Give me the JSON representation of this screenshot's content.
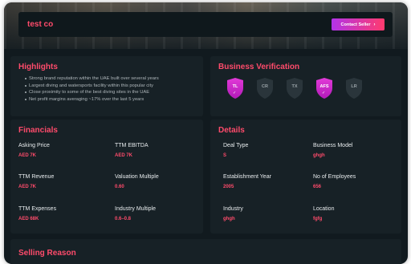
{
  "header": {
    "company_name": "test co",
    "contact_button_label": "Contact Seller",
    "contact_button_arrow": "›"
  },
  "highlights": {
    "title": "Highlights",
    "items": [
      "Strong brand reputation within the UAE built over several years",
      "Largest diving and watersports facility within this popular city",
      "Close proximity to some of the best diving sites in the UAE",
      "Net profit margins averaging ~17% over the last 5 years"
    ]
  },
  "verification": {
    "title": "Business Verification",
    "badges": [
      {
        "label": "TL",
        "active": true,
        "check": "✓"
      },
      {
        "label": "CR",
        "active": false
      },
      {
        "label": "TX",
        "active": false
      },
      {
        "label": "AFS",
        "active": true,
        "check": "✓"
      },
      {
        "label": "LR",
        "active": false
      }
    ],
    "active_color": "#d42bd6",
    "inactive_color": "#2a353b"
  },
  "financials": {
    "title": "Financials",
    "fields": [
      {
        "label": "Asking Price",
        "value": "AED 7K"
      },
      {
        "label": "TTM EBITDA",
        "value": "AED 7K"
      },
      {
        "label": "TTM Revenue",
        "value": "AED 7K"
      },
      {
        "label": "Valuation Multiple",
        "value": "0.60"
      },
      {
        "label": "TTM Expenses",
        "value": "AED 68K"
      },
      {
        "label": "Industry Multiple",
        "value": "0.6–0.8"
      }
    ]
  },
  "details": {
    "title": "Details",
    "fields": [
      {
        "label": "Deal Type",
        "value": "S"
      },
      {
        "label": "Business Model",
        "value": "ghgh"
      },
      {
        "label": "Establishment Year",
        "value": "2005"
      },
      {
        "label": "No of Employees",
        "value": "656"
      },
      {
        "label": "Industry",
        "value": "ghgh"
      },
      {
        "label": "Location",
        "value": "fgfg"
      }
    ]
  },
  "selling_reason": {
    "title": "Selling Reason"
  },
  "colors": {
    "accent": "#ff4b6b",
    "background": "#111a1f",
    "card": "#172126"
  }
}
